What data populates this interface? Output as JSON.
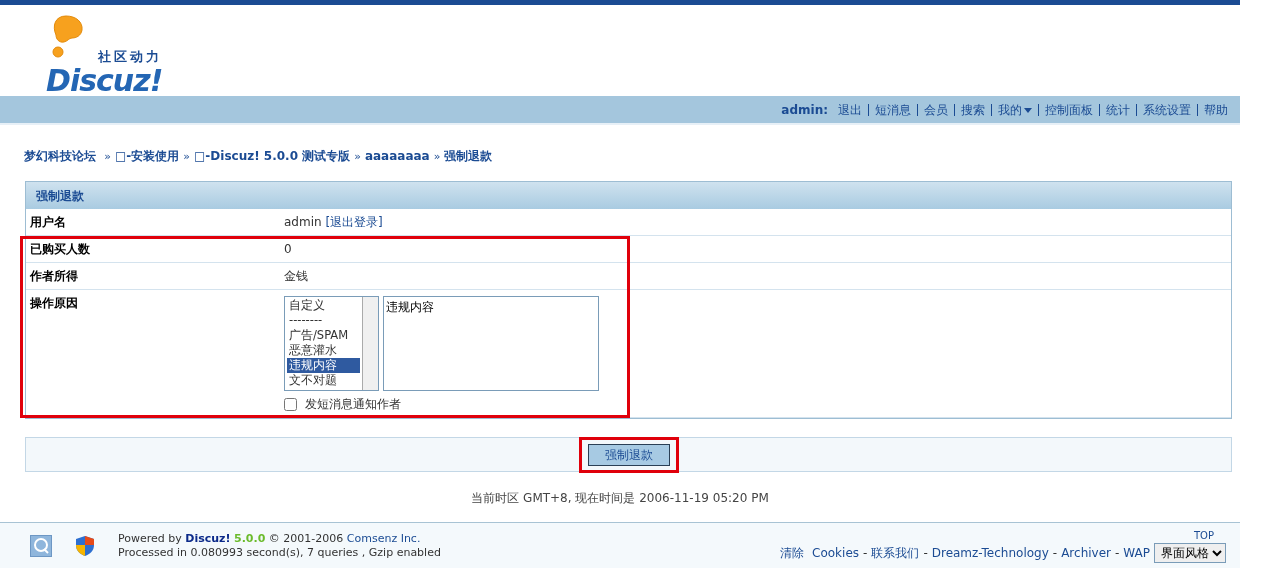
{
  "logo": {
    "tagline": "社区动力",
    "wordmark": "Discuz!"
  },
  "nav": {
    "user": "admin:",
    "links": [
      {
        "label": "退出",
        "dropdown": false
      },
      {
        "label": "短消息",
        "dropdown": false
      },
      {
        "label": "会员",
        "dropdown": false
      },
      {
        "label": "搜索",
        "dropdown": false
      },
      {
        "label": "我的",
        "dropdown": true
      },
      {
        "label": "控制面板",
        "dropdown": false
      },
      {
        "label": "统计",
        "dropdown": false
      },
      {
        "label": "系统设置",
        "dropdown": false
      },
      {
        "label": "帮助",
        "dropdown": false
      }
    ]
  },
  "breadcrumb": [
    {
      "label": "梦幻科技论坛"
    },
    {
      "prefix": "»",
      "label": "□-安装使用"
    },
    {
      "prefix": "»",
      "label": "□-Discuz! 5.0.0 测试专版"
    },
    {
      "prefix": "»",
      "label": "aaaaaaaa"
    },
    {
      "prefix": "»",
      "label": "强制退款"
    }
  ],
  "panel": {
    "title": "强制退款",
    "rows": [
      {
        "kind": "text",
        "label": "用户名",
        "value": "admin",
        "link": "[退出登录]",
        "highlighted": false
      },
      {
        "kind": "text",
        "label": "已购买人数",
        "value": "0",
        "highlighted": true
      },
      {
        "kind": "text",
        "label": "作者所得",
        "value": "金钱",
        "highlighted": true
      },
      {
        "kind": "reason",
        "label": "操作原因",
        "highlighted": true,
        "options": [
          {
            "label": "自定义",
            "selected": false
          },
          {
            "label": "--------",
            "selected": false
          },
          {
            "label": "广告/SPAM",
            "selected": false
          },
          {
            "label": "恶意灌水",
            "selected": false
          },
          {
            "label": "违规内容",
            "selected": true
          },
          {
            "label": "文不对题",
            "selected": false
          }
        ],
        "reason_text": "违规内容",
        "notify": {
          "label": "发短消息通知作者",
          "checked": false
        }
      }
    ]
  },
  "submit": {
    "label": "强制退款",
    "highlighted": true
  },
  "time_line": "当前时区  GMT+8, 现在时间是  2006-11-19 05:20 PM",
  "footer": {
    "powered": "Powered by ",
    "brand": "Discuz!",
    "version": "5.0.0",
    "copyright": "© 2001-2006",
    "company": "Comsenz Inc.",
    "processed": "Processed in 0.080993 second(s), 7 queries , Gzip enabled",
    "top": "TOP",
    "links": [
      {
        "label": "清除  Cookies"
      },
      {
        "prefix": "-",
        "label": "联系我们"
      },
      {
        "prefix": "-",
        "label": "Dreamz-Technology"
      },
      {
        "prefix": "-",
        "label": "Archiver"
      },
      {
        "prefix": "-",
        "label": "WAP"
      }
    ],
    "style_select": "界面风格"
  }
}
